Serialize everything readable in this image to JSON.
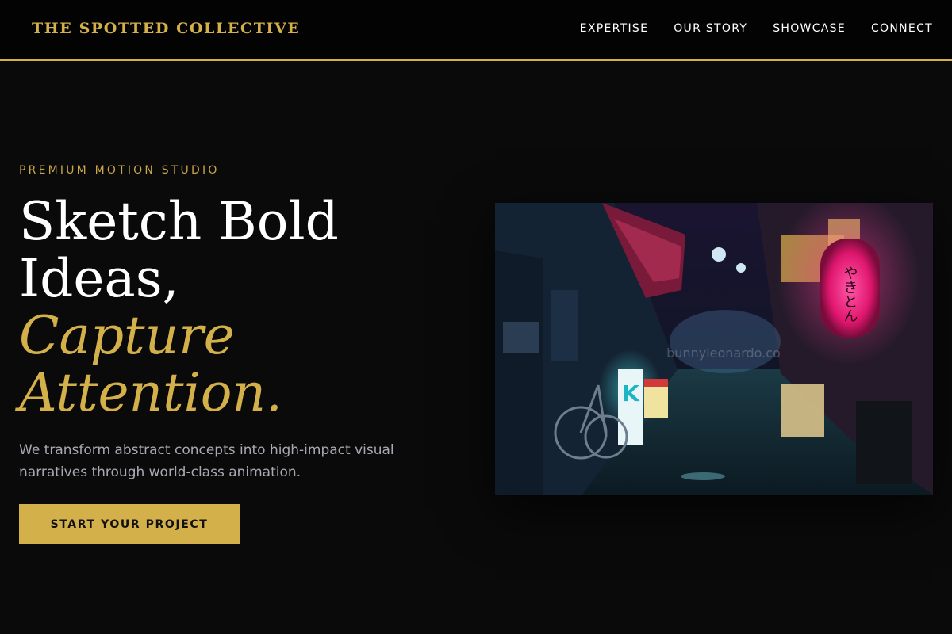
{
  "header": {
    "brand": "THE SPOTTED COLLECTIVE",
    "nav": [
      "EXPERTISE",
      "OUR STORY",
      "SHOWCASE",
      "CONNECT"
    ]
  },
  "hero": {
    "eyebrow": "PREMIUM MOTION STUDIO",
    "headline": {
      "line1": "Sketch Bold",
      "line2": "Ideas,",
      "line3": "Capture",
      "line4": "Attention."
    },
    "subtext": "We transform abstract concepts into high-impact visual narratives through world-class animation.",
    "cta_label": "START YOUR PROJECT",
    "image": {
      "description": "neon-lit Tokyo alley at night",
      "watermark": "bunnyleonardo.co",
      "sign_text": "K",
      "lantern_text": "やきとん"
    }
  },
  "colors": {
    "background": "#0a0a0a",
    "header_bg": "#030303",
    "accent_gold": "#d4b04a",
    "subtext_gray": "#a9a9b3",
    "lantern_pink": "#ff2f8e",
    "neon_cyan": "#3fd4d8"
  }
}
